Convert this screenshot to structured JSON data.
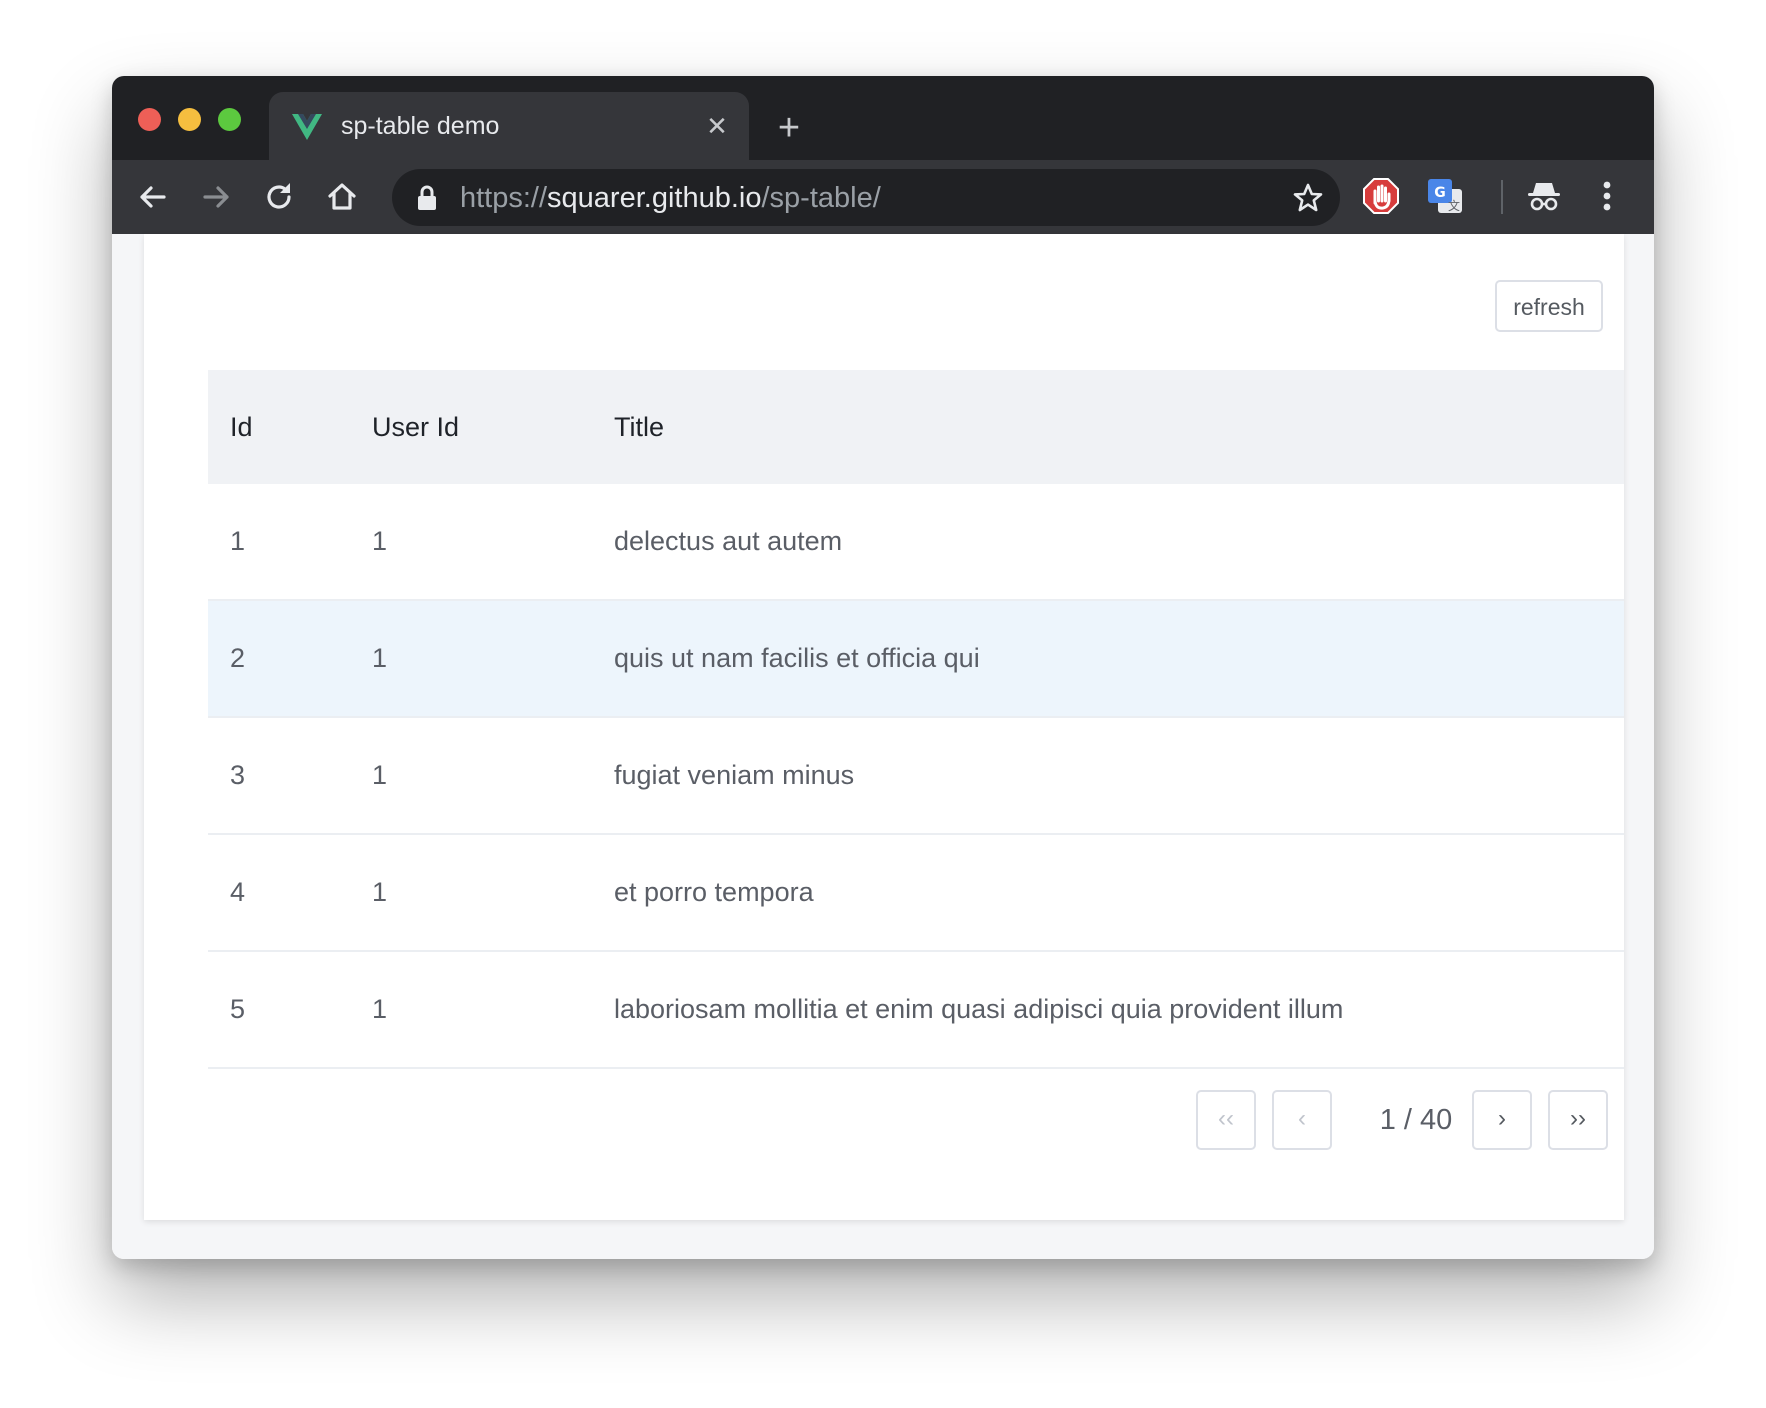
{
  "browser": {
    "tab": {
      "title": "sp-table demo",
      "favicon": "vue-logo-icon",
      "close_icon": "close-icon"
    },
    "new_tab_icon": "plus-icon",
    "url": {
      "scheme": "https://",
      "host": "squarer.github.io",
      "path": "/sp-table/"
    },
    "toolbar_icons": [
      "back-arrow-icon",
      "forward-arrow-icon",
      "reload-icon",
      "home-icon",
      "lock-icon",
      "star-icon",
      "adblock-extension-icon",
      "google-translate-icon",
      "incognito-icon",
      "more-vert-icon"
    ],
    "traffic_light_colors": [
      "#ee5f57",
      "#f5be3f",
      "#5cc93f"
    ]
  },
  "page": {
    "refresh_label": "refresh",
    "table": {
      "headers": {
        "id": "Id",
        "user_id": "User Id",
        "title": "Title"
      },
      "rows": [
        {
          "id": "1",
          "user_id": "1",
          "title": "delectus aut autem"
        },
        {
          "id": "2",
          "user_id": "1",
          "title": "quis ut nam facilis et officia qui"
        },
        {
          "id": "3",
          "user_id": "1",
          "title": "fugiat veniam minus"
        },
        {
          "id": "4",
          "user_id": "1",
          "title": "et porro tempora"
        },
        {
          "id": "5",
          "user_id": "1",
          "title": "laboriosam mollitia et enim quasi adipisci quia provident illum"
        }
      ],
      "hovered_row": 2
    },
    "pagination": {
      "first_label": "‹‹",
      "prev_label": "‹",
      "page_info": "1 / 40",
      "next_label": "›",
      "last_label": "››"
    },
    "colors": {
      "header_bg": "#f0f2f5",
      "hover_row_bg": "#edf5fc",
      "border": "#dcdfe6"
    }
  }
}
